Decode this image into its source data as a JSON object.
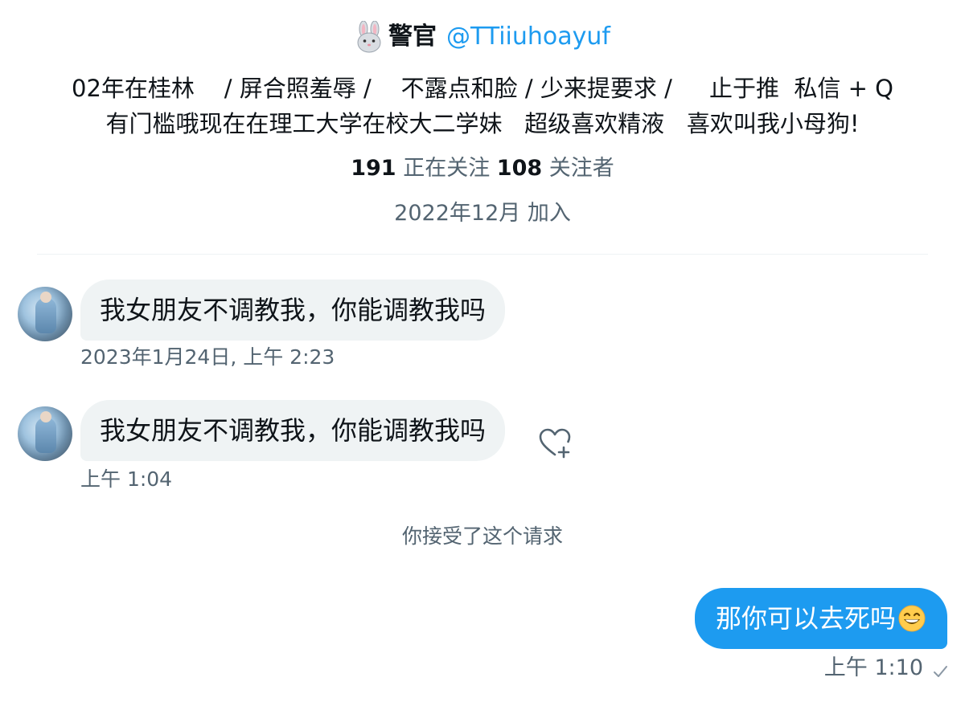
{
  "profile": {
    "emoji_icon": "rabbit-face-icon",
    "display_name": "警官",
    "handle": "@TTiiuhoayuf",
    "bio_line1": "02年在桂林    / 屏合照羞辱 /    不露点和脸 / 少来提要求 /     止于推  私信 + Q",
    "bio_line2": "有门槛哦现在在理工大学在校大二学妹   超级喜欢精液   喜欢叫我小母狗!",
    "following_count": "191",
    "following_label": "正在关注",
    "followers_count": "108",
    "followers_label": "关注者",
    "joined": "2022年12月 加入"
  },
  "messages": [
    {
      "sender": "them",
      "text": "我女朋友不调教我，你能调教我吗",
      "timestamp": "2023年1月24日, 上午 2:23"
    },
    {
      "sender": "them",
      "text": "我女朋友不调教我，你能调教我吗",
      "timestamp": "上午 1:04",
      "reaction_icon": "heart-plus-icon"
    }
  ],
  "system_notice": "你接受了这个请求",
  "reply": {
    "sender": "me",
    "text": "那你可以去死吗",
    "emoji_icon": "grinning-face-icon",
    "timestamp": "上午 1:10",
    "status_icon": "checkmark-icon"
  },
  "colors": {
    "accent": "#1d9bf0",
    "text_primary": "#0f1419",
    "text_secondary": "#536471",
    "bubble_incoming": "#eff3f4"
  }
}
